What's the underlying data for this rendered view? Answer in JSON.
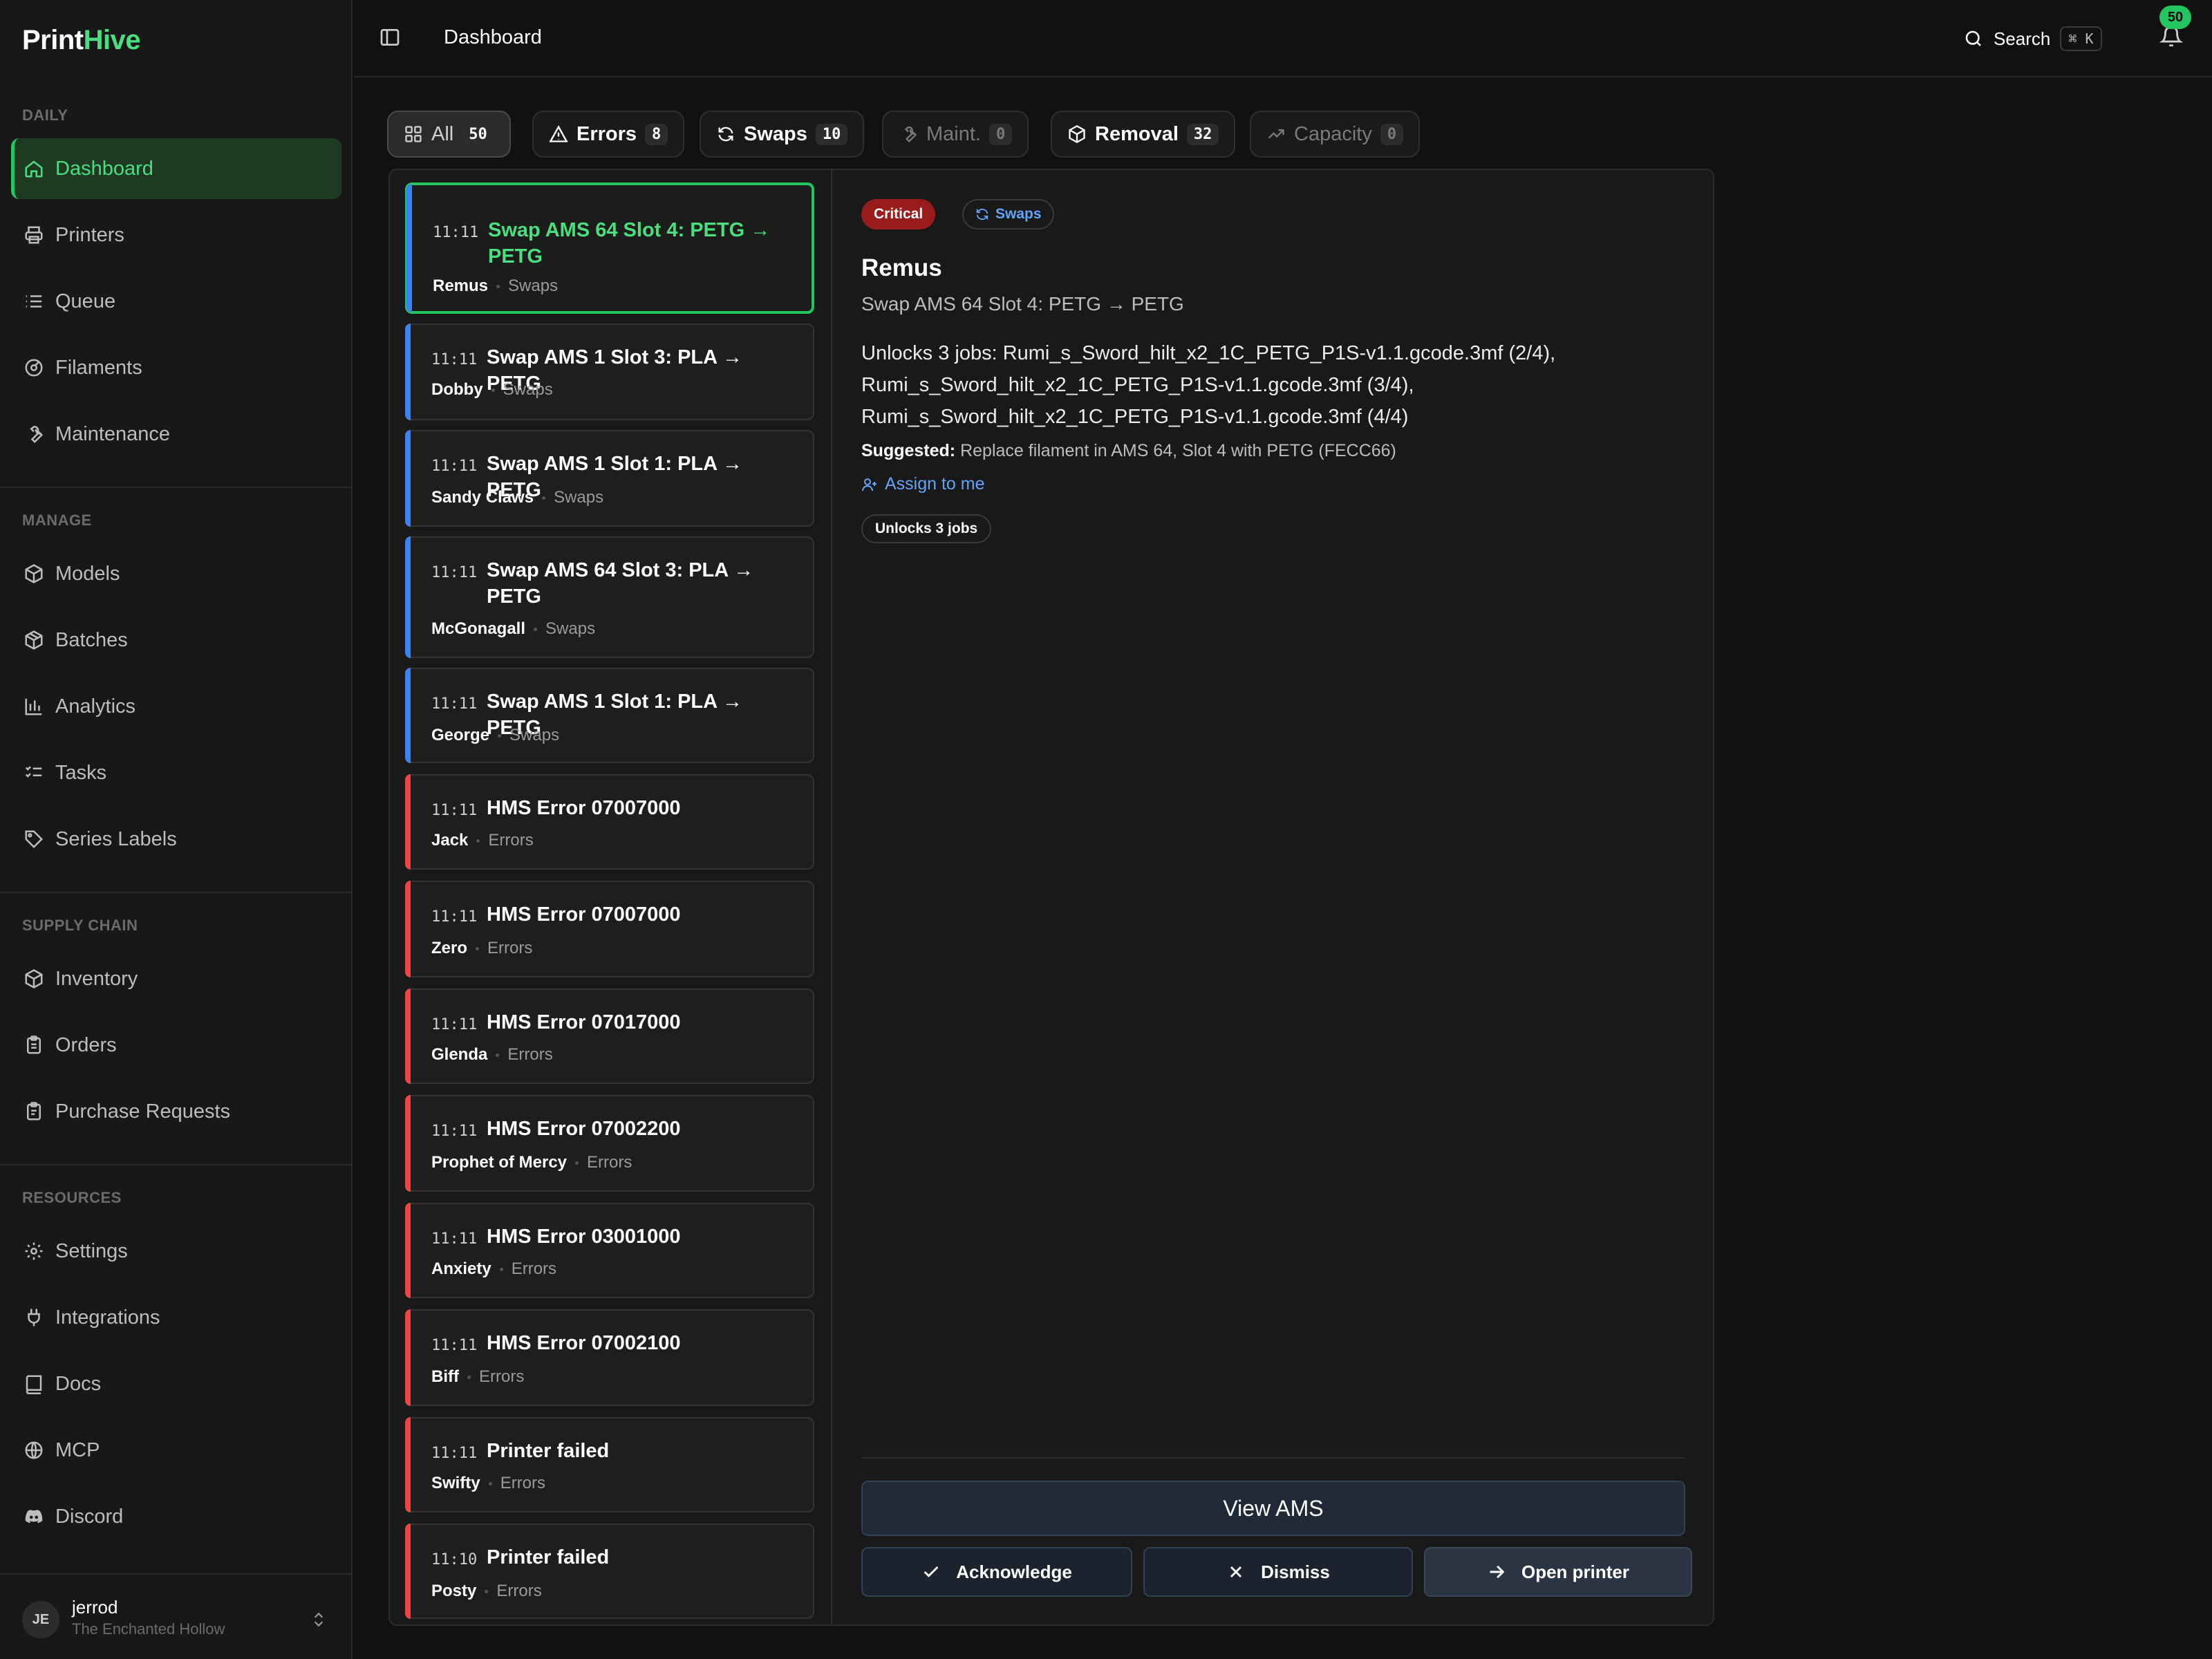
{
  "app": {
    "logo_part1": "Print",
    "logo_part2": "Hive"
  },
  "sidebar": {
    "sections": {
      "daily": "DAILY",
      "manage": "MANAGE",
      "supply": "SUPPLY CHAIN",
      "resources": "RESOURCES"
    },
    "items": {
      "dashboard": "Dashboard",
      "printers": "Printers",
      "queue": "Queue",
      "filaments": "Filaments",
      "maintenance": "Maintenance",
      "models": "Models",
      "batches": "Batches",
      "analytics": "Analytics",
      "tasks": "Tasks",
      "series_labels": "Series Labels",
      "inventory": "Inventory",
      "orders": "Orders",
      "purchase_requests": "Purchase Requests",
      "settings": "Settings",
      "integrations": "Integrations",
      "docs": "Docs",
      "mcp": "MCP",
      "discord": "Discord"
    },
    "user": {
      "initials": "JE",
      "name": "jerrod",
      "org": "The Enchanted Hollow"
    }
  },
  "topbar": {
    "breadcrumb": "Dashboard",
    "search_label": "Search",
    "search_shortcut": "⌘ K",
    "notification_count": "50"
  },
  "tabs": [
    {
      "label": "All",
      "count": "50",
      "icon": "grid-icon"
    },
    {
      "label": "Errors",
      "count": "8",
      "icon": "warning-icon"
    },
    {
      "label": "Swaps",
      "count": "10",
      "icon": "refresh-icon"
    },
    {
      "label": "Maint.",
      "count": "0",
      "icon": "wrench-icon"
    },
    {
      "label": "Removal",
      "count": "32",
      "icon": "box-icon"
    },
    {
      "label": "Capacity",
      "count": "0",
      "icon": "trend-icon"
    }
  ],
  "events": [
    {
      "time": "11:11",
      "title": "Swap AMS 64 Slot 4: PETG → PETG",
      "who": "Remus",
      "category": "Swaps"
    },
    {
      "time": "11:11",
      "title": "Swap AMS 1 Slot 3: PLA → PETG",
      "who": "Dobby",
      "category": "Swaps"
    },
    {
      "time": "11:11",
      "title": "Swap AMS 1 Slot 1: PLA → PETG",
      "who": "Sandy Claws",
      "category": "Swaps"
    },
    {
      "time": "11:11",
      "title": "Swap AMS 64 Slot 3: PLA → PETG",
      "who": "McGonagall",
      "category": "Swaps"
    },
    {
      "time": "11:11",
      "title": "Swap AMS 1 Slot 1: PLA → PETG",
      "who": "George",
      "category": "Swaps"
    },
    {
      "time": "11:11",
      "title": "HMS Error 07007000",
      "who": "Jack",
      "category": "Errors"
    },
    {
      "time": "11:11",
      "title": "HMS Error 07007000",
      "who": "Zero",
      "category": "Errors"
    },
    {
      "time": "11:11",
      "title": "HMS Error 07017000",
      "who": "Glenda",
      "category": "Errors"
    },
    {
      "time": "11:11",
      "title": "HMS Error 07002200",
      "who": "Prophet of Mercy",
      "category": "Errors"
    },
    {
      "time": "11:11",
      "title": "HMS Error 03001000",
      "who": "Anxiety",
      "category": "Errors"
    },
    {
      "time": "11:11",
      "title": "HMS Error 07002100",
      "who": "Biff",
      "category": "Errors"
    },
    {
      "time": "11:11",
      "title": "Printer failed",
      "who": "Swifty",
      "category": "Errors"
    },
    {
      "time": "11:10",
      "title": "Printer failed",
      "who": "Posty",
      "category": "Errors"
    }
  ],
  "detail": {
    "severity": "Critical",
    "category": "Swaps",
    "printer": "Remus",
    "subtitle": "Swap AMS 64 Slot 4: PETG → PETG",
    "unlocks_text": "Unlocks 3 jobs: Rumi_s_Sword_hilt_x2_1C_PETG_P1S-v1.1.gcode.3mf (2/4), Rumi_s_Sword_hilt_x2_1C_PETG_P1S-v1.1.gcode.3mf (3/4), Rumi_s_Sword_hilt_x2_1C_PETG_P1S-v1.1.gcode.3mf (4/4)",
    "suggested_label": "Suggested:",
    "suggested_text": "Replace filament in AMS 64, Slot 4 with PETG (FECC66)",
    "assign_label": "Assign to me",
    "chip": "Unlocks 3 jobs",
    "view_button": "View AMS",
    "acknowledge": "Acknowledge",
    "dismiss": "Dismiss",
    "open_printer": "Open printer"
  },
  "colors": {
    "accent": "#22c55e",
    "swap_bar": "#3b82f6",
    "error_bar": "#ef4444",
    "critical": "#991b1b",
    "link": "#60a5fa"
  }
}
